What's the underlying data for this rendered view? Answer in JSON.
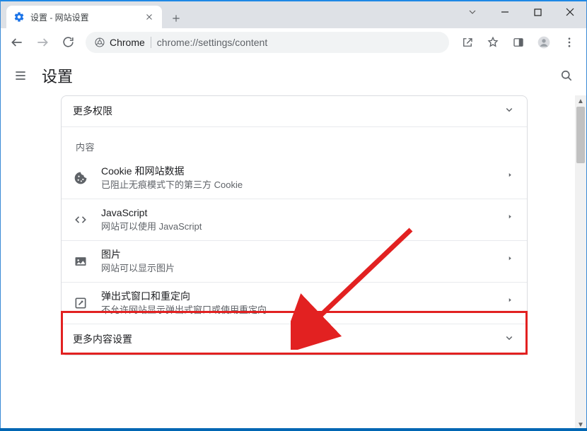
{
  "window": {
    "tab_title": "设置 - 网站设置",
    "chrome_chip": "Chrome",
    "url": "chrome://settings/content"
  },
  "header": {
    "title": "设置"
  },
  "card": {
    "more_permissions": "更多权限",
    "section_content": "内容",
    "more_content_settings": "更多内容设置",
    "rows": {
      "cookies": {
        "title": "Cookie 和网站数据",
        "sub": "已阻止无痕模式下的第三方 Cookie"
      },
      "javascript": {
        "title": "JavaScript",
        "sub": "网站可以使用 JavaScript"
      },
      "images": {
        "title": "图片",
        "sub": "网站可以显示图片"
      },
      "popups": {
        "title": "弹出式窗口和重定向",
        "sub": "不允许网站显示弹出式窗口或使用重定向"
      }
    }
  }
}
